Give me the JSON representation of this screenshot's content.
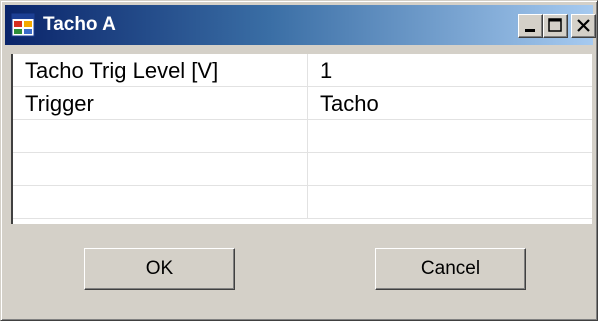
{
  "window": {
    "title": "Tacho A",
    "icon": "application-window-icon",
    "controls": {
      "minimize": "minimize-icon",
      "maximize": "maximize-icon",
      "close": "close-icon"
    }
  },
  "grid": {
    "rows": [
      {
        "name": "Tacho Trig Level [V]",
        "value": "1"
      },
      {
        "name": "Trigger",
        "value": "Tacho"
      },
      {
        "name": "",
        "value": ""
      },
      {
        "name": "",
        "value": ""
      },
      {
        "name": "",
        "value": ""
      }
    ]
  },
  "buttons": {
    "ok_label": "OK",
    "cancel_label": "Cancel"
  },
  "colors": {
    "title_start": "#0a246a",
    "title_end": "#a6caf0",
    "face": "#d4d0c8"
  }
}
